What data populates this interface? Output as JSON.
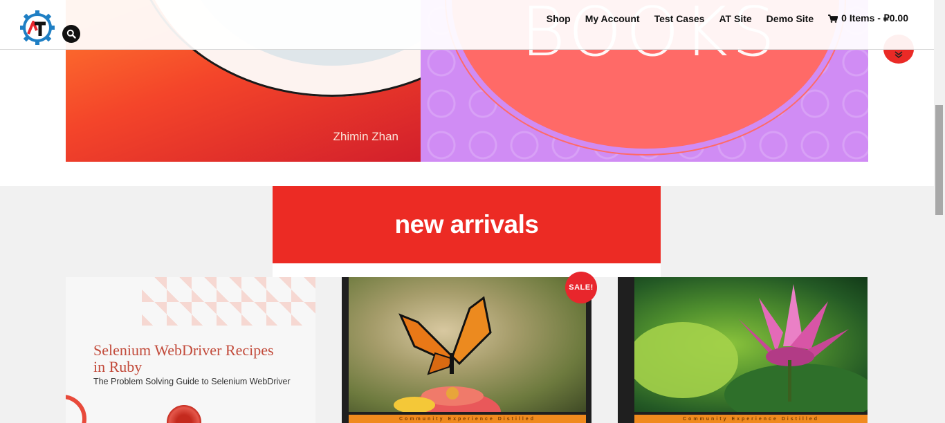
{
  "header": {
    "nav": [
      {
        "label": "Shop"
      },
      {
        "label": "My Account"
      },
      {
        "label": "Test Cases"
      },
      {
        "label": "AT Site"
      },
      {
        "label": "Demo Site"
      }
    ],
    "cart_label": "0 Items - ₽0.00",
    "logo_text": "AT",
    "icons": {
      "search": "search-icon",
      "cart": "cart-icon",
      "scroll": "double-chevron-down-icon"
    }
  },
  "slider": {
    "left_author": "Zhimin Zhan",
    "right_word": "BOOKS"
  },
  "section": {
    "title": "new arrivals"
  },
  "products": [
    {
      "title_line1": "Selenium WebDriver Recipes",
      "title_line2": "in Ruby",
      "subtitle": "The Problem Solving Guide to Selenium WebDriver"
    },
    {
      "badge": "SALE!",
      "strip": "Community Experience Distilled"
    },
    {
      "strip": "Community Experience Distilled"
    }
  ],
  "colors": {
    "accent": "#ec2b24",
    "banner_purple": "#d08cf4",
    "banner_coral": "#ff6a67"
  }
}
